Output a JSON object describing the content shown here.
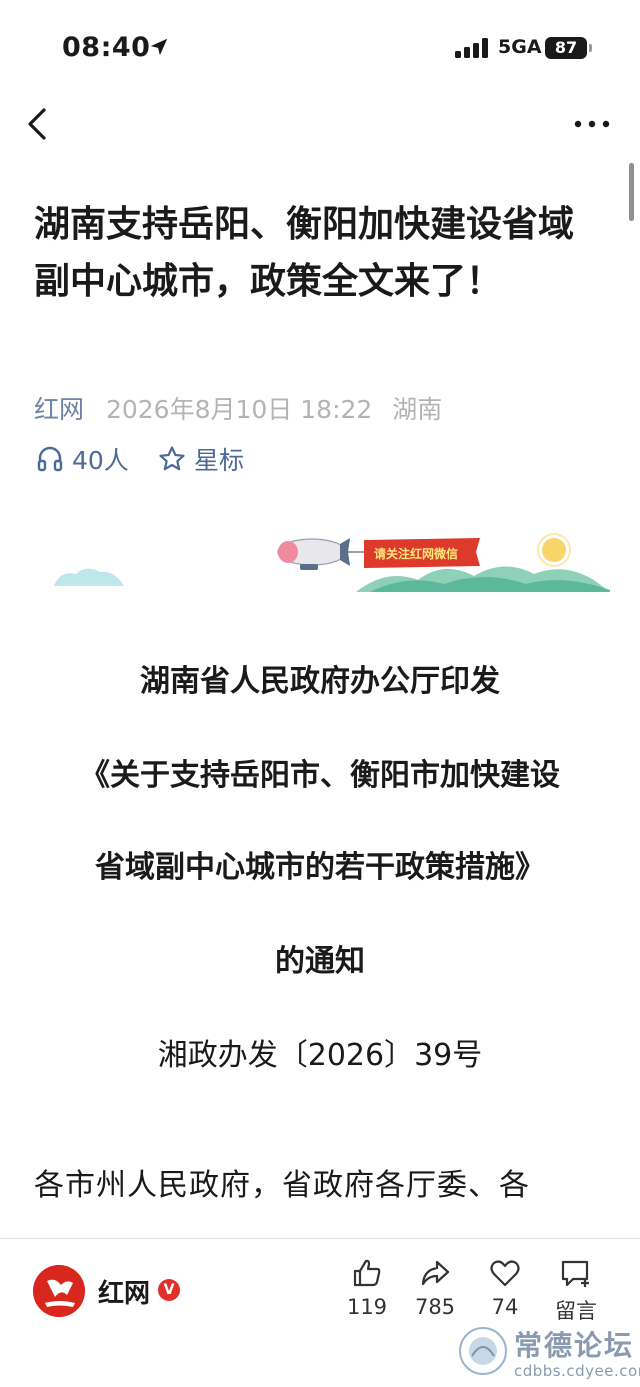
{
  "status_bar": {
    "time": "08:40",
    "network": "5GA",
    "battery": "87"
  },
  "article": {
    "title": "湖南支持岳阳、衡阳加快建设省域副中心城市，政策全文来了！",
    "source": "红网",
    "date": "2026年8月10日 18:22",
    "region": "湖南",
    "listeners": "40人",
    "star_label": "星标",
    "banner_text": "请关注红网微信",
    "heading_lines": [
      "湖南省人民政府办公厅印发",
      "《关于支持岳阳市、衡阳市加快建设",
      "省域副中心城市的若干政策措施》",
      "的通知"
    ],
    "doc_number": "湘政办发〔2026〕39号",
    "body_first_line": "各市州人民政府，省政府各厅委、各"
  },
  "bottom_bar": {
    "account": "红网",
    "likes": "119",
    "shares": "785",
    "favorites": "74",
    "comment_label": "留言"
  },
  "watermark": {
    "title": "常德论坛",
    "url": "cdbbs.cdyee.com"
  },
  "colors": {
    "accent_blue": "#4d6a97",
    "brand_red": "#d9271d",
    "meta_gray": "#b4b4b4"
  }
}
